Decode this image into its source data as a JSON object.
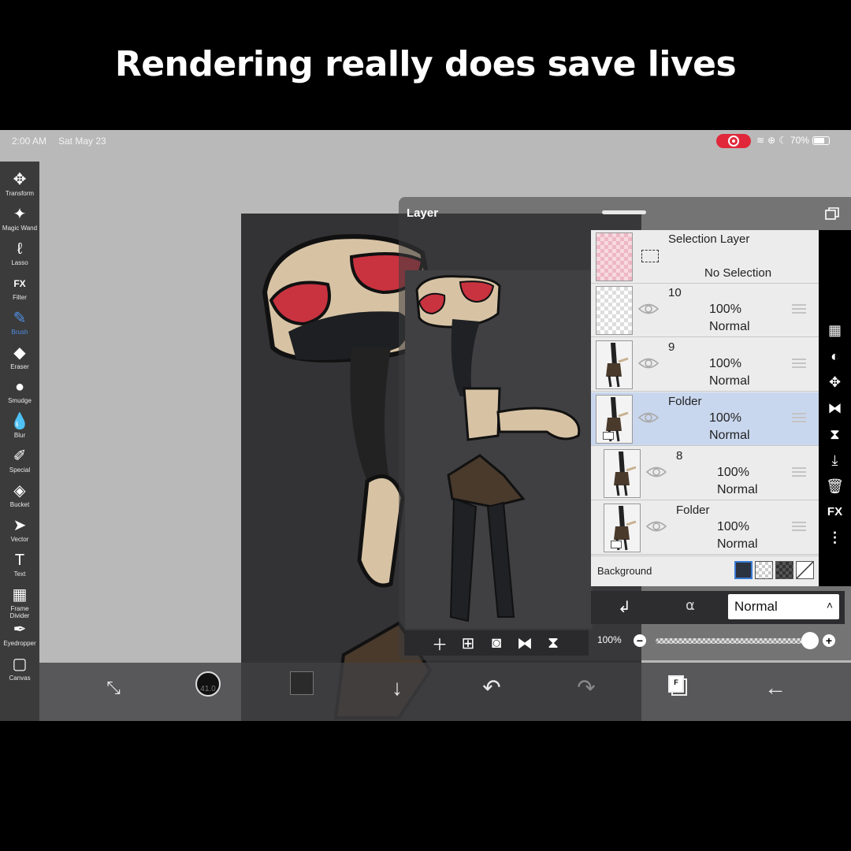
{
  "caption": "Rendering really does save lives",
  "status_bar": {
    "time": "2:00 AM",
    "date": "Sat May 23",
    "battery": "70%"
  },
  "toolbar": {
    "tools": [
      {
        "label": "Transform",
        "icon": "transform-icon",
        "glyph": "✥"
      },
      {
        "label": "Magic Wand",
        "icon": "magic-wand-icon",
        "glyph": "✦"
      },
      {
        "label": "Lasso",
        "icon": "lasso-icon",
        "glyph": "ℓ"
      },
      {
        "label": "Filter",
        "icon": "filter-icon",
        "glyph": "FX"
      },
      {
        "label": "Brush",
        "icon": "brush-icon",
        "glyph": "✎"
      },
      {
        "label": "Eraser",
        "icon": "eraser-icon",
        "glyph": "◆"
      },
      {
        "label": "Smudge",
        "icon": "smudge-icon",
        "glyph": "●"
      },
      {
        "label": "Blur",
        "icon": "blur-icon",
        "glyph": "💧"
      },
      {
        "label": "Special",
        "icon": "special-icon",
        "glyph": "✐"
      },
      {
        "label": "Bucket",
        "icon": "bucket-icon",
        "glyph": "◈"
      },
      {
        "label": "Vector",
        "icon": "vector-icon",
        "glyph": "➤"
      },
      {
        "label": "Text",
        "icon": "text-icon",
        "glyph": "T"
      },
      {
        "label": "Frame Divider",
        "icon": "frame-divider-icon",
        "glyph": "▦"
      },
      {
        "label": "Eyedropper",
        "icon": "eyedropper-icon",
        "glyph": "✒"
      },
      {
        "label": "Canvas",
        "icon": "canvas-icon",
        "glyph": "▢"
      }
    ],
    "active": "Brush"
  },
  "layer_panel": {
    "title": "Layer",
    "selection_layer": {
      "name": "Selection Layer",
      "state": "No Selection"
    },
    "layers": [
      {
        "name": "10",
        "opacity": "100%",
        "mode": "Normal",
        "selected": false
      },
      {
        "name": "9",
        "opacity": "100%",
        "mode": "Normal",
        "selected": false
      },
      {
        "name": "Folder",
        "opacity": "100%",
        "mode": "Normal",
        "selected": true
      },
      {
        "name": "8",
        "opacity": "100%",
        "mode": "Normal",
        "selected": false
      },
      {
        "name": "Folder",
        "opacity": "100%",
        "mode": "Normal",
        "selected": false
      }
    ],
    "background_label": "Background",
    "blend_mode": "Normal",
    "opacity_label": "100%",
    "opacity_value": 1.0,
    "side_icons": [
      "checker-icon",
      "half-circle-icon",
      "move-icon",
      "flip-horizontal-icon",
      "flip-vertical-icon",
      "merge-down-icon",
      "trash-icon",
      "fx-icon",
      "more-icon"
    ],
    "fx_label": "FX"
  },
  "bottom_toolbar": {
    "brush_size": "41.0",
    "thumb_label": "F"
  },
  "colors": {
    "accent": "#4f8fe6",
    "selected_row": "#c9d7ee",
    "record": "#e0283a"
  }
}
